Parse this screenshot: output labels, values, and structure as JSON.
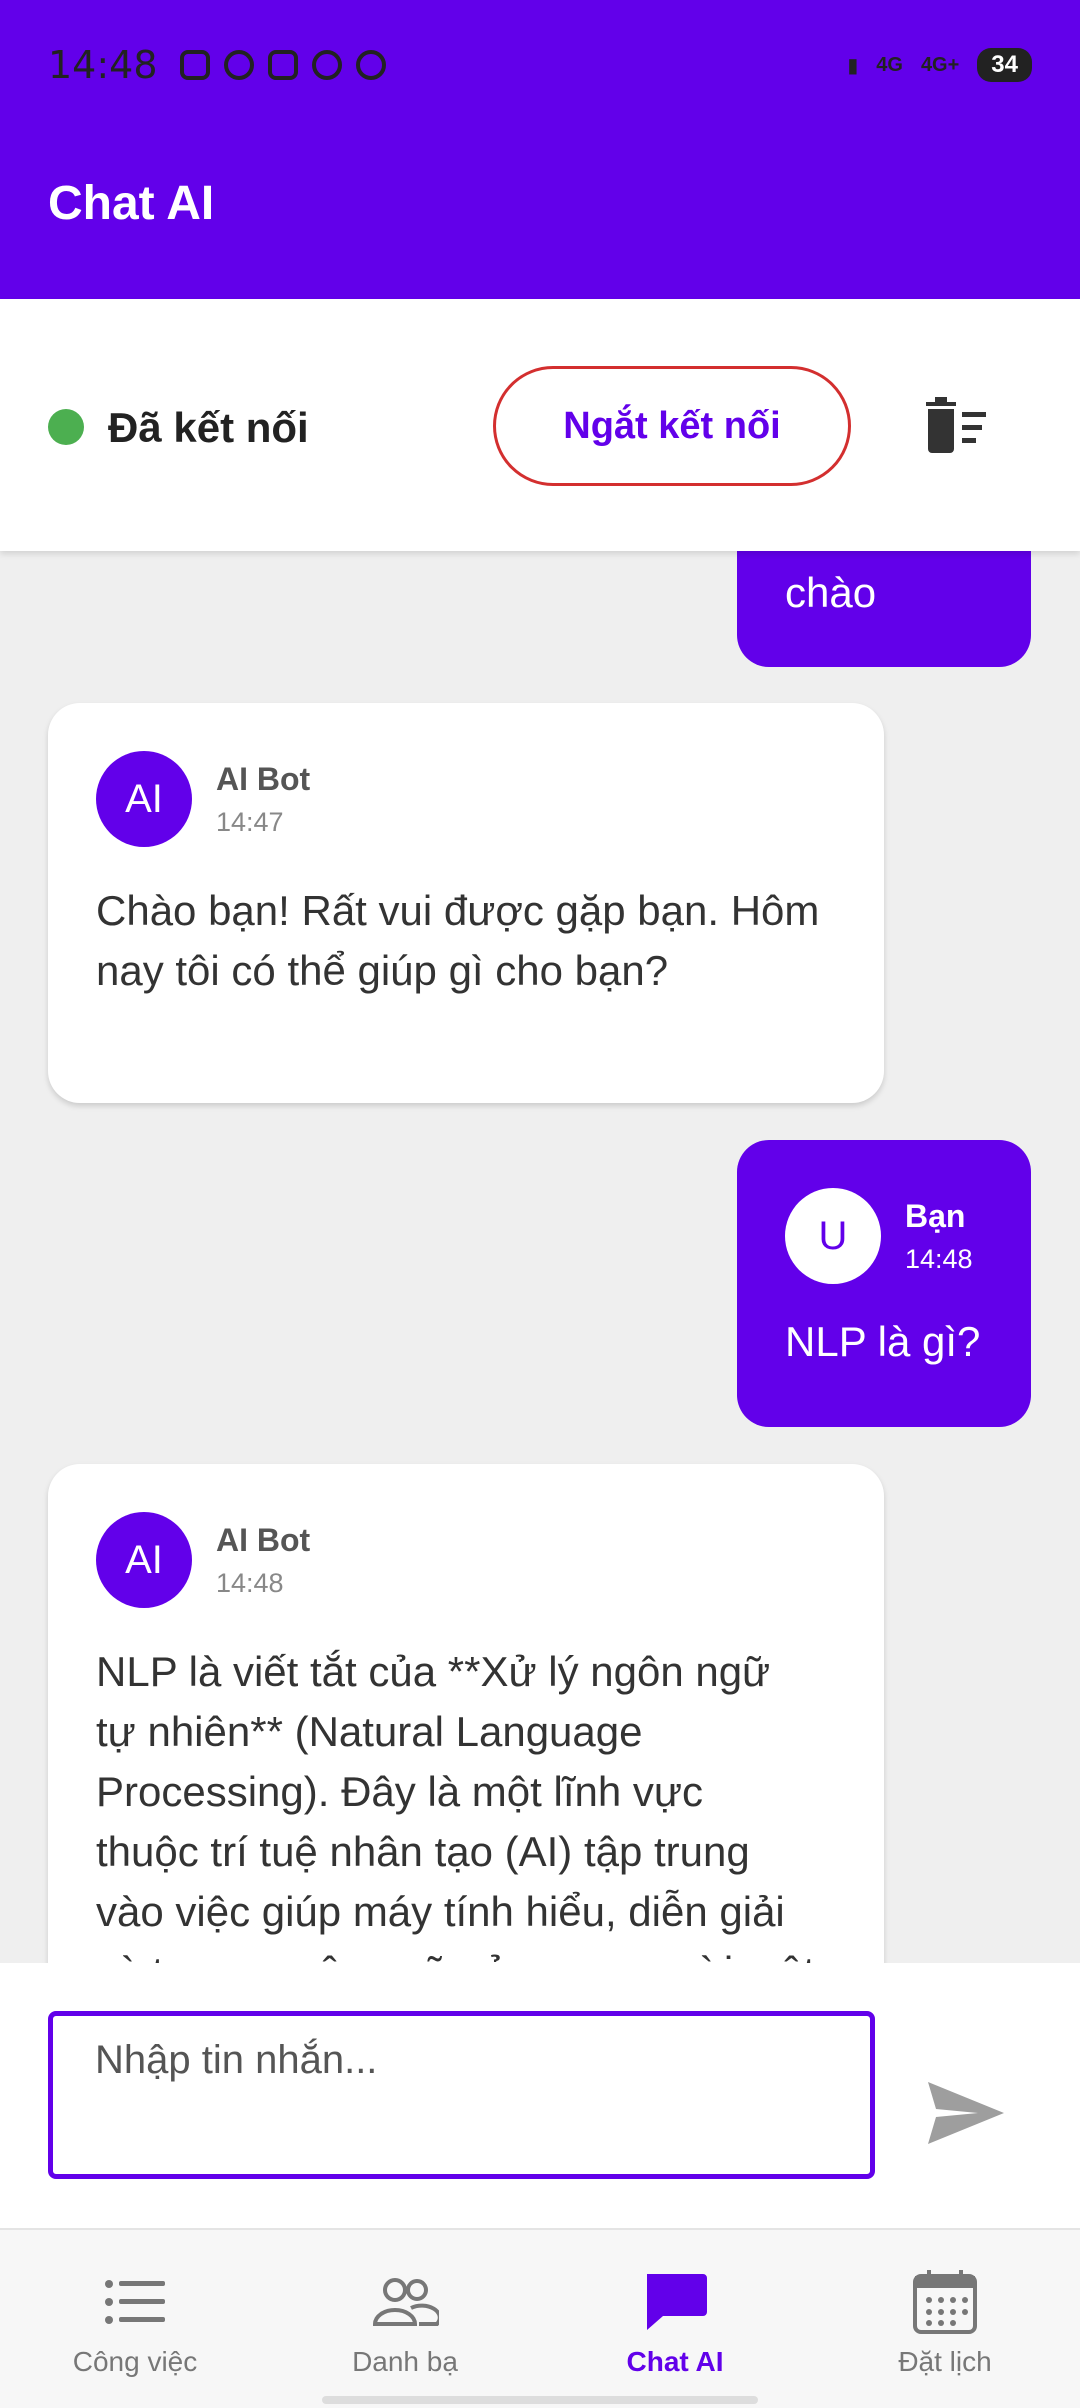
{
  "status_bar": {
    "time": "14:48",
    "network": [
      "4G",
      "4G+"
    ],
    "battery": "34"
  },
  "app_bar": {
    "title": "Chat AI"
  },
  "connection": {
    "status": "Đã kết nối",
    "disconnect_label": "Ngắt kết nối",
    "status_color": "#4caf50"
  },
  "messages": [
    {
      "role": "user",
      "text": "chào"
    },
    {
      "role": "bot",
      "avatar": "AI",
      "sender": "AI Bot",
      "time": "14:47",
      "text": "Chào bạn! Rất vui được gặp bạn. Hôm nay tôi có thể giúp gì cho bạn?"
    },
    {
      "role": "user",
      "avatar": "U",
      "sender": "Bạn",
      "time": "14:48",
      "text": "NLP là gì?"
    },
    {
      "role": "bot",
      "avatar": "AI",
      "sender": "AI Bot",
      "time": "14:48",
      "text": "NLP là viết tắt của **Xử lý ngôn ngữ tự nhiên** (Natural Language Processing). Đây là một lĩnh vực thuộc trí tuệ nhân tạo (AI) tập trung vào việc giúp máy tính hiểu, diễn giải và tạo ra ngôn ngữ của con người một cách có ý nghĩa."
    }
  ],
  "input": {
    "placeholder": "Nhập tin nhắn..."
  },
  "nav": [
    {
      "label": "Công việc",
      "icon": "list-icon"
    },
    {
      "label": "Danh bạ",
      "icon": "contacts-icon"
    },
    {
      "label": "Chat AI",
      "icon": "chat-icon",
      "active": true
    },
    {
      "label": "Đặt lịch",
      "icon": "calendar-icon"
    }
  ],
  "colors": {
    "primary": "#6200ea",
    "danger": "#d32f2f"
  }
}
